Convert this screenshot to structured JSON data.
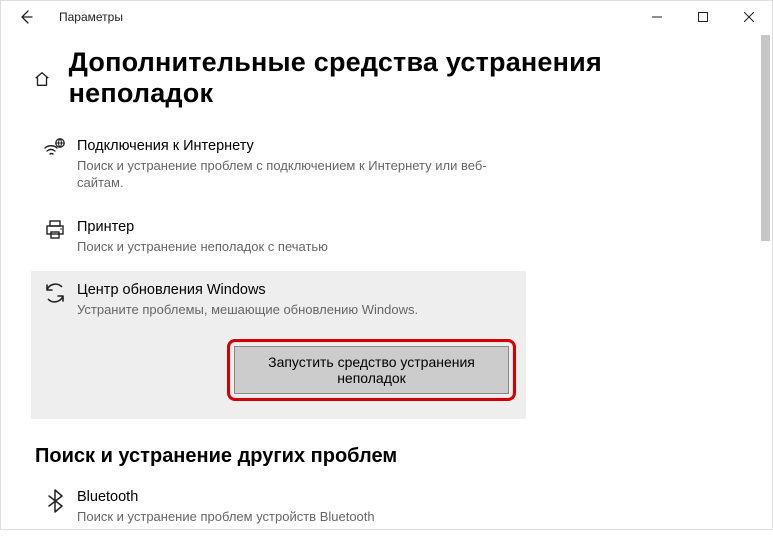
{
  "window": {
    "title": "Параметры"
  },
  "page": {
    "title": "Дополнительные средства устранения неполадок"
  },
  "troubleshooters": [
    {
      "title": "Подключения к Интернету",
      "desc": "Поиск и устранение проблем с подключением к Интернету или веб-сайтам."
    },
    {
      "title": "Принтер",
      "desc": "Поиск и устранение неполадок с печатью"
    },
    {
      "title": "Центр обновления Windows",
      "desc": "Устраните проблемы, мешающие обновлению Windows."
    }
  ],
  "run_button": "Запустить средство устранения неполадок",
  "section2": {
    "title": "Поиск и устранение других проблем"
  },
  "bluetooth": {
    "title": "Bluetooth",
    "desc": "Поиск и устранение проблем устройств Bluetooth"
  }
}
